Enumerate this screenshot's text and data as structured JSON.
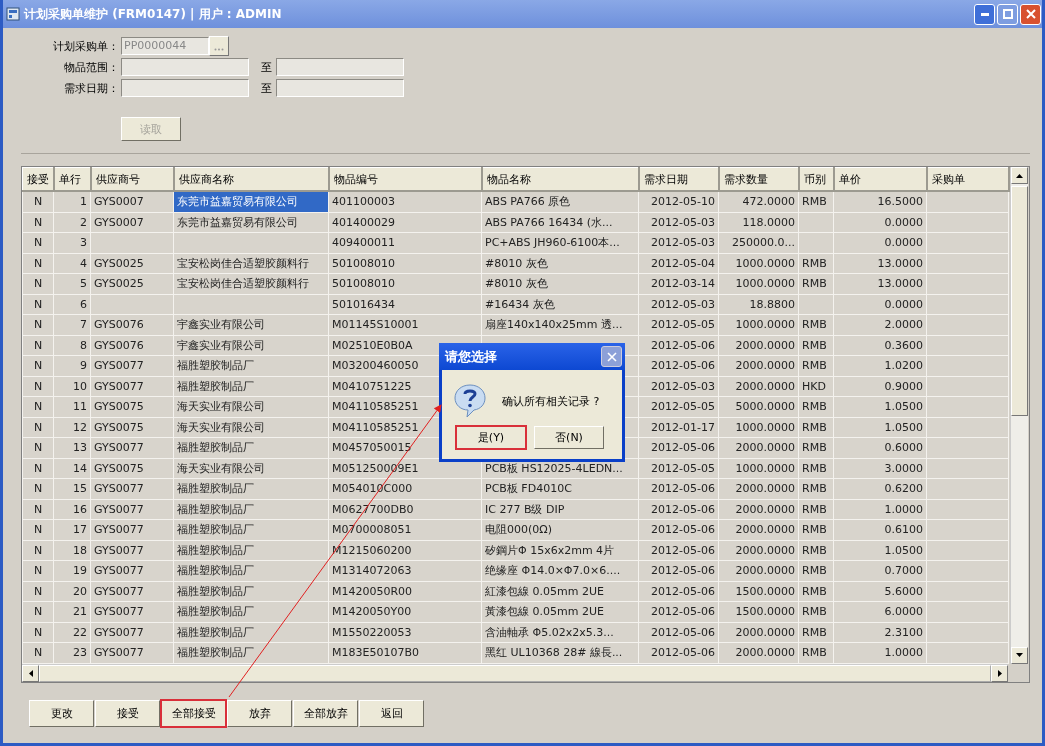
{
  "window": {
    "title": "计划采购单维护 (FRM0147) | 用户 : ADMIN"
  },
  "filters": {
    "order_label": "计划采购单：",
    "order_value": "PP0000044",
    "item_label": "物品范围：",
    "date_label": "需求日期：",
    "item_to_label": "至",
    "date_to_label": "至",
    "read_button": {
      "label": "读取",
      "disabled": true
    }
  },
  "table": {
    "columns": [
      "接受",
      "单行",
      "供应商号",
      "供应商名称",
      "物品编号",
      "物品名称",
      "需求日期",
      "需求数量",
      "币别",
      "单价",
      "采购单"
    ],
    "rows": [
      {
        "cells": [
          "N",
          "1",
          "GYS0007",
          "东莞市益嘉贸易有限公司",
          "401100003",
          "ABS  PA766  原色",
          "2012-05-10",
          "472.0000",
          "RMB",
          "16.5000"
        ],
        "selected": true
      },
      {
        "cells": [
          "N",
          "2",
          "GYS0007",
          "东莞市益嘉贸易有限公司",
          "401400029",
          "ABS  PA766  16434 (水...",
          "2012-05-03",
          "118.0000",
          "",
          "0.0000"
        ],
        "selected": false
      },
      {
        "cells": [
          "N",
          "3",
          "",
          "",
          "409400011",
          "PC+ABS JH960-6100本...",
          "2012-05-03",
          "250000.0...",
          "",
          "0.0000"
        ],
        "selected": false
      },
      {
        "cells": [
          "N",
          "4",
          "GYS0025",
          "宝安松岗佳合适塑胶颜料行",
          "501008010",
          "#8010   灰色",
          "2012-05-04",
          "1000.0000",
          "RMB",
          "13.0000"
        ],
        "selected": false
      },
      {
        "cells": [
          "N",
          "5",
          "GYS0025",
          "宝安松岗佳合适塑胶颜料行",
          "501008010",
          "#8010   灰色",
          "2012-03-14",
          "1000.0000",
          "RMB",
          "13.0000"
        ],
        "selected": false
      },
      {
        "cells": [
          "N",
          "6",
          "",
          "",
          "501016434",
          "#16434  灰色",
          "2012-05-03",
          "18.8800",
          "",
          "0.0000"
        ],
        "selected": false
      },
      {
        "cells": [
          "N",
          "7",
          "GYS0076",
          "宇鑫实业有限公司",
          "M01145S10001",
          "扇座140x140x25mm 透...",
          "2012-05-05",
          "1000.0000",
          "RMB",
          "2.0000"
        ],
        "selected": false
      },
      {
        "cells": [
          "N",
          "8",
          "GYS0076",
          "宇鑫实业有限公司",
          "M02510E0B0A",
          "",
          "2012-05-06",
          "2000.0000",
          "RMB",
          "0.3600"
        ],
        "selected": false
      },
      {
        "cells": [
          "N",
          "9",
          "GYS0077",
          "福胜塑胶制品厂",
          "M03200460050",
          "",
          "2012-05-06",
          "2000.0000",
          "RMB",
          "1.0200"
        ],
        "selected": false
      },
      {
        "cells": [
          "N",
          "10",
          "GYS0077",
          "福胜塑胶制品厂",
          "M0410751225",
          "",
          "2012-05-03",
          "2000.0000",
          "HKD",
          "0.9000"
        ],
        "selected": false
      },
      {
        "cells": [
          "N",
          "11",
          "GYS0075",
          "海天实业有限公司",
          "M04110585251",
          "",
          "2012-05-05",
          "5000.0000",
          "RMB",
          "1.0500"
        ],
        "selected": false
      },
      {
        "cells": [
          "N",
          "12",
          "GYS0075",
          "海天实业有限公司",
          "M04110585251",
          "",
          "2012-01-17",
          "1000.0000",
          "RMB",
          "1.0500"
        ],
        "selected": false
      },
      {
        "cells": [
          "N",
          "13",
          "GYS0077",
          "福胜塑胶制品厂",
          "M0457050015",
          "",
          "2012-05-06",
          "2000.0000",
          "RMB",
          "0.6000"
        ],
        "selected": false
      },
      {
        "cells": [
          "N",
          "14",
          "GYS0075",
          "海天实业有限公司",
          "M051250009E1",
          "PCB板  HS12025-4LEDN...",
          "2012-05-05",
          "1000.0000",
          "RMB",
          "3.0000"
        ],
        "selected": false
      },
      {
        "cells": [
          "N",
          "15",
          "GYS0077",
          "福胜塑胶制品厂",
          "M054010C000",
          "PCB板 FD4010C",
          "2012-05-06",
          "2000.0000",
          "RMB",
          "0.6200"
        ],
        "selected": false
      },
      {
        "cells": [
          "N",
          "16",
          "GYS0077",
          "福胜塑胶制品厂",
          "M0627700DB0",
          "IC  277  B级   DIP",
          "2012-05-06",
          "2000.0000",
          "RMB",
          "1.0000"
        ],
        "selected": false
      },
      {
        "cells": [
          "N",
          "17",
          "GYS0077",
          "福胜塑胶制品厂",
          "M0700008051",
          "电阻000(0Ω)",
          "2012-05-06",
          "2000.0000",
          "RMB",
          "0.6100"
        ],
        "selected": false
      },
      {
        "cells": [
          "N",
          "18",
          "GYS0077",
          "福胜塑胶制品厂",
          "M1215060200",
          "矽鋼片Φ 15x6x2mm  4片",
          "2012-05-06",
          "2000.0000",
          "RMB",
          "1.0500"
        ],
        "selected": false
      },
      {
        "cells": [
          "N",
          "19",
          "GYS0077",
          "福胜塑胶制品厂",
          "M1314072063",
          "绝缘座 Φ14.0×Φ7.0×6....",
          "2012-05-06",
          "2000.0000",
          "RMB",
          "0.7000"
        ],
        "selected": false
      },
      {
        "cells": [
          "N",
          "20",
          "GYS0077",
          "福胜塑胶制品厂",
          "M1420050R00",
          "紅漆包線 0.05mm  2UE",
          "2012-05-06",
          "1500.0000",
          "RMB",
          "5.6000"
        ],
        "selected": false
      },
      {
        "cells": [
          "N",
          "21",
          "GYS0077",
          "福胜塑胶制品厂",
          "M1420050Y00",
          "黃漆包線 0.05mm  2UE",
          "2012-05-06",
          "1500.0000",
          "RMB",
          "6.0000"
        ],
        "selected": false
      },
      {
        "cells": [
          "N",
          "22",
          "GYS0077",
          "福胜塑胶制品厂",
          "M1550220053",
          "含油軸承  Φ5.02x2x5.3...",
          "2012-05-06",
          "2000.0000",
          "RMB",
          "2.3100"
        ],
        "selected": false
      },
      {
        "cells": [
          "N",
          "23",
          "GYS0077",
          "福胜塑胶制品厂",
          "M183E50107B0",
          "黑红 UL10368 28# 線長...",
          "2012-05-06",
          "2000.0000",
          "RMB",
          "1.0000"
        ],
        "selected": false
      }
    ]
  },
  "buttons": [
    {
      "label": "更改",
      "highlighted": false
    },
    {
      "label": "接受",
      "highlighted": false
    },
    {
      "label": "全部接受",
      "highlighted": true
    },
    {
      "label": "放弃",
      "highlighted": false
    },
    {
      "label": "全部放弃",
      "highlighted": false
    },
    {
      "label": "返回",
      "highlighted": false
    }
  ],
  "dialog": {
    "title": "请您选择",
    "message": "确认所有相关记录 ?",
    "buttons": [
      {
        "label": "是(Y)",
        "highlighted": true
      },
      {
        "label": "否(N)",
        "highlighted": false
      }
    ]
  }
}
